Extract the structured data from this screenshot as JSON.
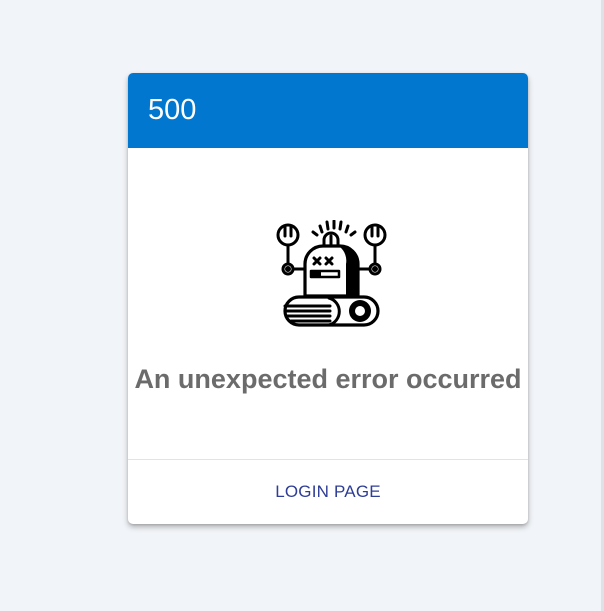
{
  "error": {
    "code": "500",
    "message": "An unexpected error occurred",
    "illustration": "broken-robot-icon"
  },
  "footer": {
    "login_label": "LOGIN PAGE"
  },
  "colors": {
    "header_bg": "#0277cf",
    "header_text": "#ffffff",
    "page_bg": "#f1f4f8",
    "message_text": "#6b6b6b",
    "link_text": "#2e3d96"
  }
}
